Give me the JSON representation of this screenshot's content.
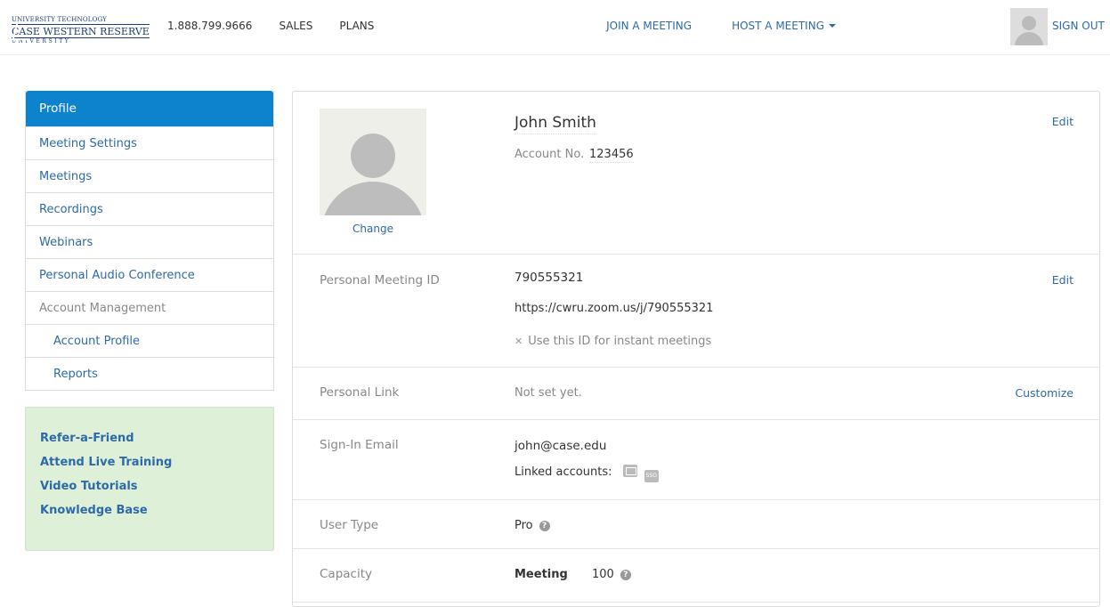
{
  "header": {
    "logo": {
      "line1": "UNIVERSITY TECHNOLOGY",
      "line2": "CASE WESTERN RESERVE",
      "line3": "UNIVERSITY"
    },
    "phone": "1.888.799.9666",
    "sales": "SALES",
    "plans": "PLANS",
    "join_meeting": "JOIN A MEETING",
    "host_meeting": "HOST A MEETING",
    "sign_out": "SIGN OUT"
  },
  "sidebar": {
    "items": [
      {
        "label": "Profile"
      },
      {
        "label": "Meeting Settings"
      },
      {
        "label": "Meetings"
      },
      {
        "label": "Recordings"
      },
      {
        "label": "Webinars"
      },
      {
        "label": "Personal Audio Conference"
      },
      {
        "label": "Account Management"
      },
      {
        "label": "Account Profile"
      },
      {
        "label": "Reports"
      }
    ]
  },
  "help": {
    "links": [
      "Refer-a-Friend",
      "Attend Live Training",
      "Video Tutorials",
      "Knowledge Base"
    ]
  },
  "profile": {
    "change": "Change",
    "name": "John Smith",
    "account_label": "Account No.",
    "account_no": "123456",
    "edit": "Edit"
  },
  "pmi": {
    "label": "Personal Meeting ID",
    "id": "790555321",
    "url": "https://cwru.zoom.us/j/790555321",
    "instant": "Use this ID for instant meetings",
    "edit": "Edit"
  },
  "personal_link": {
    "label": "Personal Link",
    "value": "Not set yet.",
    "action": "Customize"
  },
  "signin": {
    "label": "Sign-In Email",
    "email": "john@case.edu",
    "linked_label": "Linked accounts:",
    "sso": "SSO"
  },
  "user_type": {
    "label": "User Type",
    "value": "Pro"
  },
  "capacity": {
    "label": "Capacity",
    "meeting_label": "Meeting",
    "meeting_value": "100"
  },
  "colors": {
    "accent": "#0e83cd",
    "link": "#2d6aa8",
    "help_bg": "#dff0d8"
  }
}
